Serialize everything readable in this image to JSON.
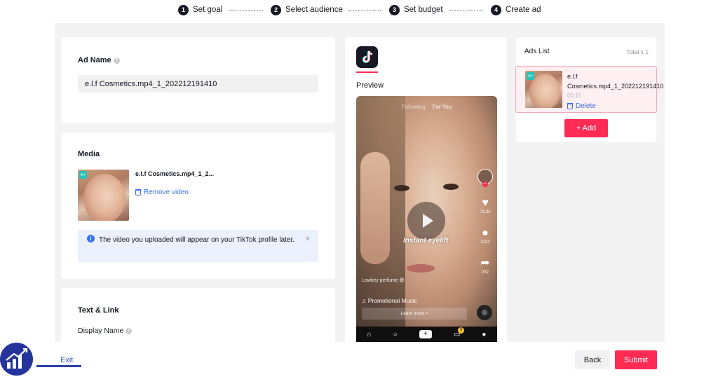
{
  "steps": [
    {
      "num": "1",
      "label": "Set goal"
    },
    {
      "num": "2",
      "label": "Select audience"
    },
    {
      "num": "3",
      "label": "Set budget"
    },
    {
      "num": "4",
      "label": "Create ad"
    }
  ],
  "ad_name": {
    "title": "Ad Name",
    "value": "e.l.f Cosmetics.mp4_1_202212191410"
  },
  "media": {
    "title": "Media",
    "file_name": "e.l.f Cosmetics.mp4_1_2...",
    "remove_label": "Remove video",
    "info_text": "The video you uploaded will appear on your TikTok profile later.",
    "close_glyph": "×"
  },
  "text_link": {
    "title": "Text & Link",
    "display_name_label": "Display Name"
  },
  "preview": {
    "label": "Preview",
    "top_tabs_dim": "Following",
    "top_tab_active": "For You",
    "caption": "Instant eyelift",
    "lowkey_text": "Lowkey perfume 😅",
    "music_text": "♫ Promotional Music",
    "learn_more": "Learn more >",
    "counts": {
      "likes": "71.3k",
      "comments": "1231",
      "shares": "232"
    },
    "nav_badge": "9",
    "nav_items": [
      "home-icon",
      "search-icon",
      "plus-icon",
      "inbox-icon",
      "profile-icon"
    ]
  },
  "ads_list": {
    "title": "Ads List",
    "total": "Total x 1",
    "item_name": "e.l.f Cosmetics.mp4_1_202212191410",
    "item_duration": "00:15",
    "delete_label": "Delete",
    "add_label": "+ Add"
  },
  "footer": {
    "exit_label": "Exit",
    "back_label": "Back",
    "submit_label": "Submit"
  },
  "colors": {
    "accent": "#fe2c55",
    "link": "#3a72e0",
    "info_bg": "#eaf1fc",
    "text": "#161823"
  }
}
